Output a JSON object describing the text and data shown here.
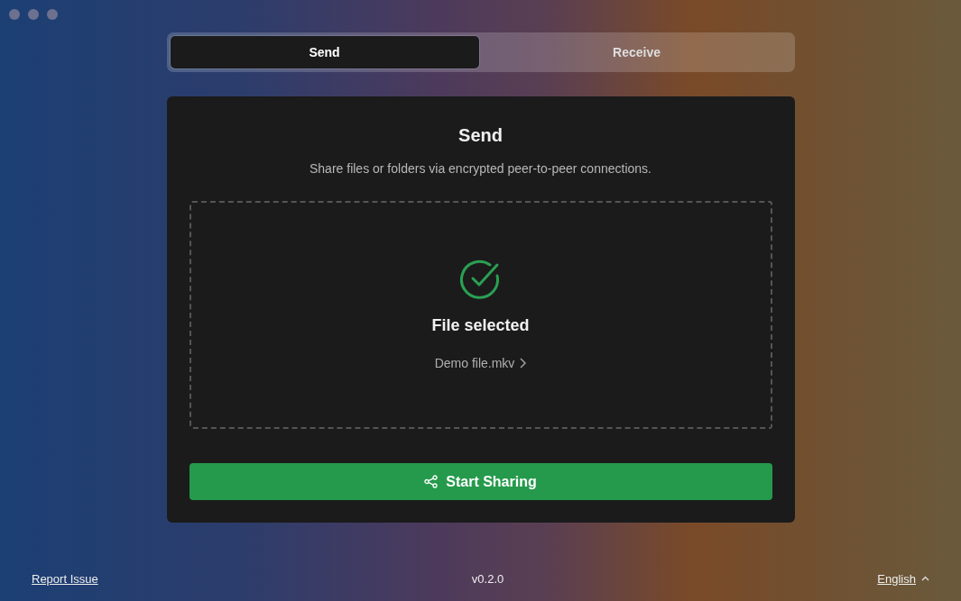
{
  "tabs": [
    {
      "label": "Send",
      "selected": true
    },
    {
      "label": "Receive",
      "selected": false
    }
  ],
  "panel": {
    "title": "Send",
    "subtitle": "Share files or folders via encrypted peer-to-peer connections.",
    "dropzone": {
      "file_selected": true,
      "status": "File selected",
      "file_name": "Demo file.mkv"
    },
    "button": {
      "label": "Start Sharing"
    }
  },
  "footer": {
    "link": "Report Issue",
    "version": "v0.2.0",
    "language": "English"
  }
}
